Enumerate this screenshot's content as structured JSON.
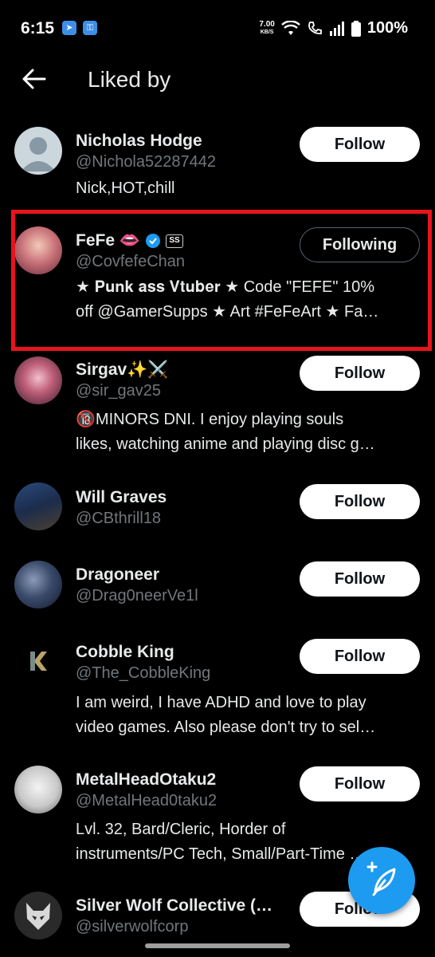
{
  "status_bar": {
    "time": "6:15",
    "speed_value": "7.00",
    "speed_unit": "KB/S",
    "battery": "100%"
  },
  "header": {
    "title": "Liked by"
  },
  "users": [
    {
      "name": "Nicholas Hodge",
      "handle": "@Nichola52287442",
      "bio": [
        "Nick,HOT,chill"
      ],
      "button": "Follow"
    },
    {
      "name": "FeFe 👄",
      "handle": "@CovfefeChan",
      "bio": [
        "★ 𝐏𝐮𝐧𝐤 𝐚𝐬𝐬 𝐕𝐭𝐮𝐛𝐞𝐫 ★ Code \"FEFE\" 10%",
        "off @GamerSupps ★ Art #FeFeArt ★ Fa…"
      ],
      "button": "Following",
      "verified": true,
      "badge": "SS"
    },
    {
      "name": "Sirgav✨⚔️",
      "handle": "@sir_gav25",
      "bio": [
        "🔞MINORS DNI. I enjoy playing souls",
        "likes, watching anime and playing disc g…"
      ],
      "button": "Follow"
    },
    {
      "name": "Will Graves",
      "handle": "@CBthrill18",
      "bio": [],
      "button": "Follow"
    },
    {
      "name": "Dragoneer",
      "handle": "@Drag0neerVe1l",
      "bio": [],
      "button": "Follow"
    },
    {
      "name": "Cobble King",
      "handle": "@The_CobbleKing",
      "bio": [
        "I am weird, I have ADHD and love to play",
        "video games. Also please don't try to sel…"
      ],
      "button": "Follow"
    },
    {
      "name": "MetalHeadOtaku2",
      "handle": "@MetalHead0taku2",
      "bio": [
        "Lvl. 32, Bard/Cleric, Horder of",
        "instruments/PC Tech, Small/Part-Time …"
      ],
      "button": "Follow"
    },
    {
      "name": "Silver Wolf Collective (…",
      "handle": "@silverwolfcorp",
      "bio": [],
      "button": "Follow"
    }
  ],
  "colors": {
    "background": "#000000",
    "primary_text": "#e7e9ea",
    "secondary_text": "#71767b",
    "accent": "#1d9bf0",
    "highlight": "#e8141c"
  }
}
